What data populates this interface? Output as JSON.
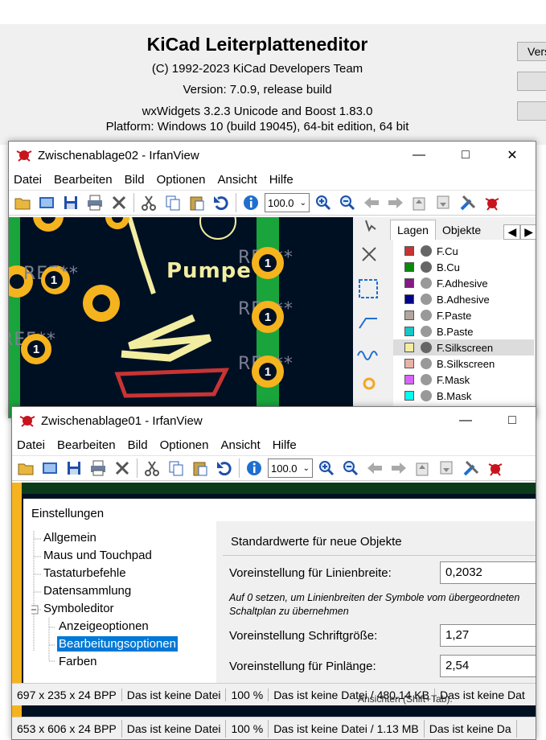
{
  "about": {
    "title": "KiCad Leiterplatteneditor",
    "copyright": "(C) 1992-2023 KiCad Developers Team",
    "version": "Version: 7.0.9, release build",
    "wx": "wxWidgets 3.2.3 Unicode and Boost 1.83.0",
    "platform": "Platform: Windows 10 (build 19045), 64-bit edition, 64 bit",
    "side_button_label": "Vers"
  },
  "window2": {
    "title": "Zwischenablage02 - IrfanView",
    "zoom": "100.0",
    "status": [
      "697 x 235 x 24 BPP",
      "Das ist keine Datei",
      "100 %",
      "Das ist keine Datei / 480.14 KB",
      "Das ist keine Dat"
    ],
    "pcb_label": "Pumpe",
    "ref_text": "REF**",
    "pad_number": "1",
    "layers_tabs": [
      "Lagen",
      "Objekte"
    ],
    "layers": [
      {
        "name": "F.Cu",
        "color": "#c83434"
      },
      {
        "name": "B.Cu",
        "color": "#098a09"
      },
      {
        "name": "F.Adhesive",
        "color": "#841a84"
      },
      {
        "name": "B.Adhesive",
        "color": "#040488"
      },
      {
        "name": "F.Paste",
        "color": "#b4a59f"
      },
      {
        "name": "B.Paste",
        "color": "#19c6c6"
      },
      {
        "name": "F.Silkscreen",
        "color": "#f2eda1"
      },
      {
        "name": "B.Silkscreen",
        "color": "#e8b2a7"
      },
      {
        "name": "F.Mask",
        "color": "#d864ff"
      },
      {
        "name": "B.Mask",
        "color": "#02ffee"
      }
    ]
  },
  "window1": {
    "title": "Zwischenablage01 - IrfanView",
    "zoom": "100.0",
    "status": [
      "653 x 606 x 24 BPP",
      "Das ist keine Datei",
      "100 %",
      "Das ist keine Datei / 1.13 MB",
      "Das ist keine Da"
    ],
    "settings": {
      "title": "Einstellungen",
      "tree": [
        {
          "label": "Allgemein",
          "level": 0
        },
        {
          "label": "Maus und Touchpad",
          "level": 0
        },
        {
          "label": "Tastaturbefehle",
          "level": 0
        },
        {
          "label": "Datensammlung",
          "level": 0
        },
        {
          "label": "Symboleditor",
          "level": 0
        },
        {
          "label": "Anzeigeoptionen",
          "level": 1
        },
        {
          "label": "Bearbeitungsoptionen",
          "level": 1,
          "selected": true
        },
        {
          "label": "Farben",
          "level": 1
        }
      ],
      "section_title": "Standardwerte für neue Objekte",
      "line_width_label": "Voreinstellung für Linienbreite:",
      "line_width_value": "0,2032",
      "hint": "Auf 0 setzen, um Linienbreiten der Symbole vom übergeordneten Schaltplan zu übernehmen",
      "font_size_label": "Voreinstellung Schriftgröße:",
      "font_size_value": "1,27",
      "pin_length_label": "Voreinstellung für Pinlänge:",
      "pin_length_value": "2,54",
      "partial_tooltip": "Ansichten (Shift+Tab)."
    }
  },
  "menu": [
    "Datei",
    "Bearbeiten",
    "Bild",
    "Optionen",
    "Ansicht",
    "Hilfe"
  ],
  "colors": {
    "selection": "#0078d7",
    "pcb_bg": "#001023",
    "pad": "#f5b31d",
    "silk": "#f2eda1"
  }
}
